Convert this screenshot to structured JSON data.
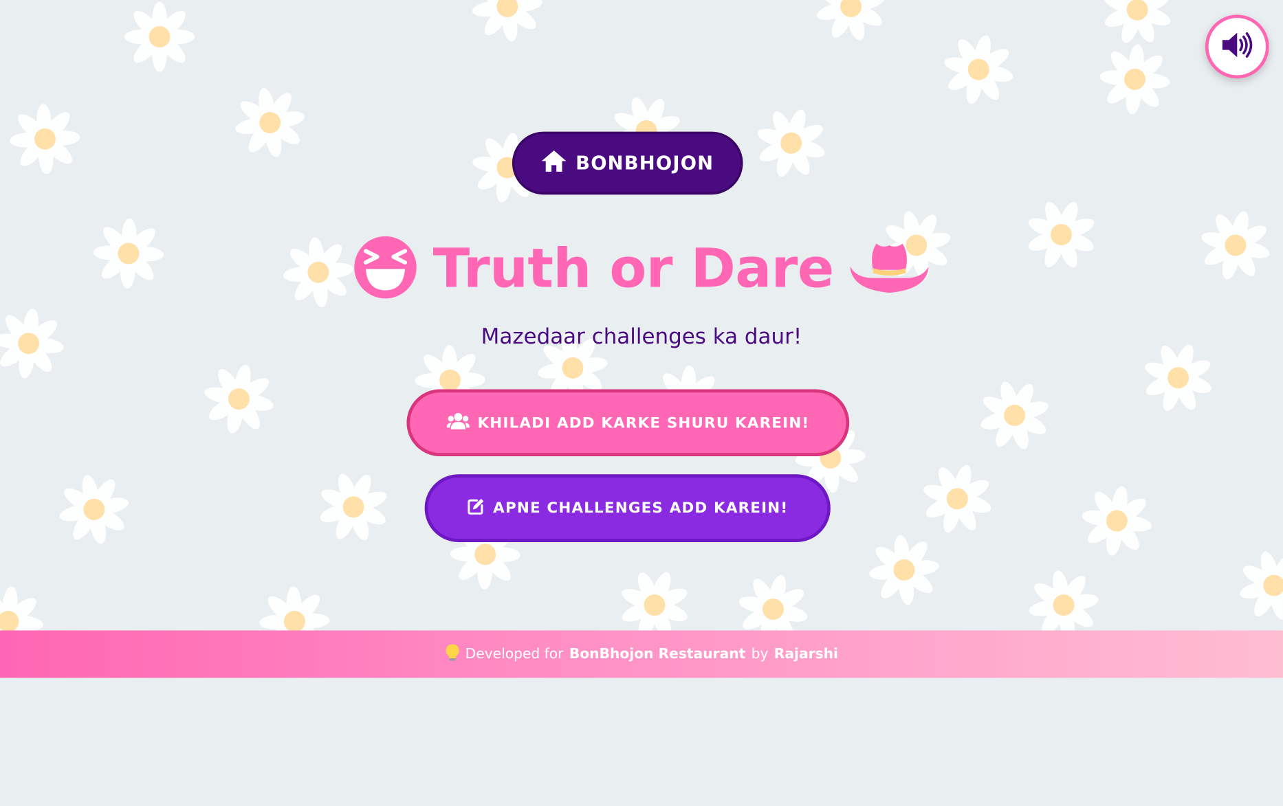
{
  "sound_button": {
    "icon": "volume-icon"
  },
  "home_button": {
    "label": "BONBHOJON",
    "icon": "home-icon"
  },
  "title": {
    "text": "Truth or Dare",
    "left_icon": "laughing-face-icon",
    "right_icon": "cowboy-hat-icon"
  },
  "subtitle": "Mazedaar challenges ka daur!",
  "buttons": {
    "add_players": {
      "label": "KHILADI ADD KARKE SHURU KAREIN!",
      "icon": "users-icon"
    },
    "add_challenges": {
      "label": "APNE CHALLENGES ADD KAREIN!",
      "icon": "edit-icon"
    }
  },
  "footer": {
    "icon": "lightbulb-icon",
    "prefix": "Developed for",
    "restaurant": "BonBhojon Restaurant",
    "by": "by",
    "author": "Rajarshi"
  },
  "colors": {
    "background": "#e9eef0",
    "pink": "#ff66b3",
    "purple_dark": "#4a0a80",
    "purple": "#8a2be2"
  }
}
